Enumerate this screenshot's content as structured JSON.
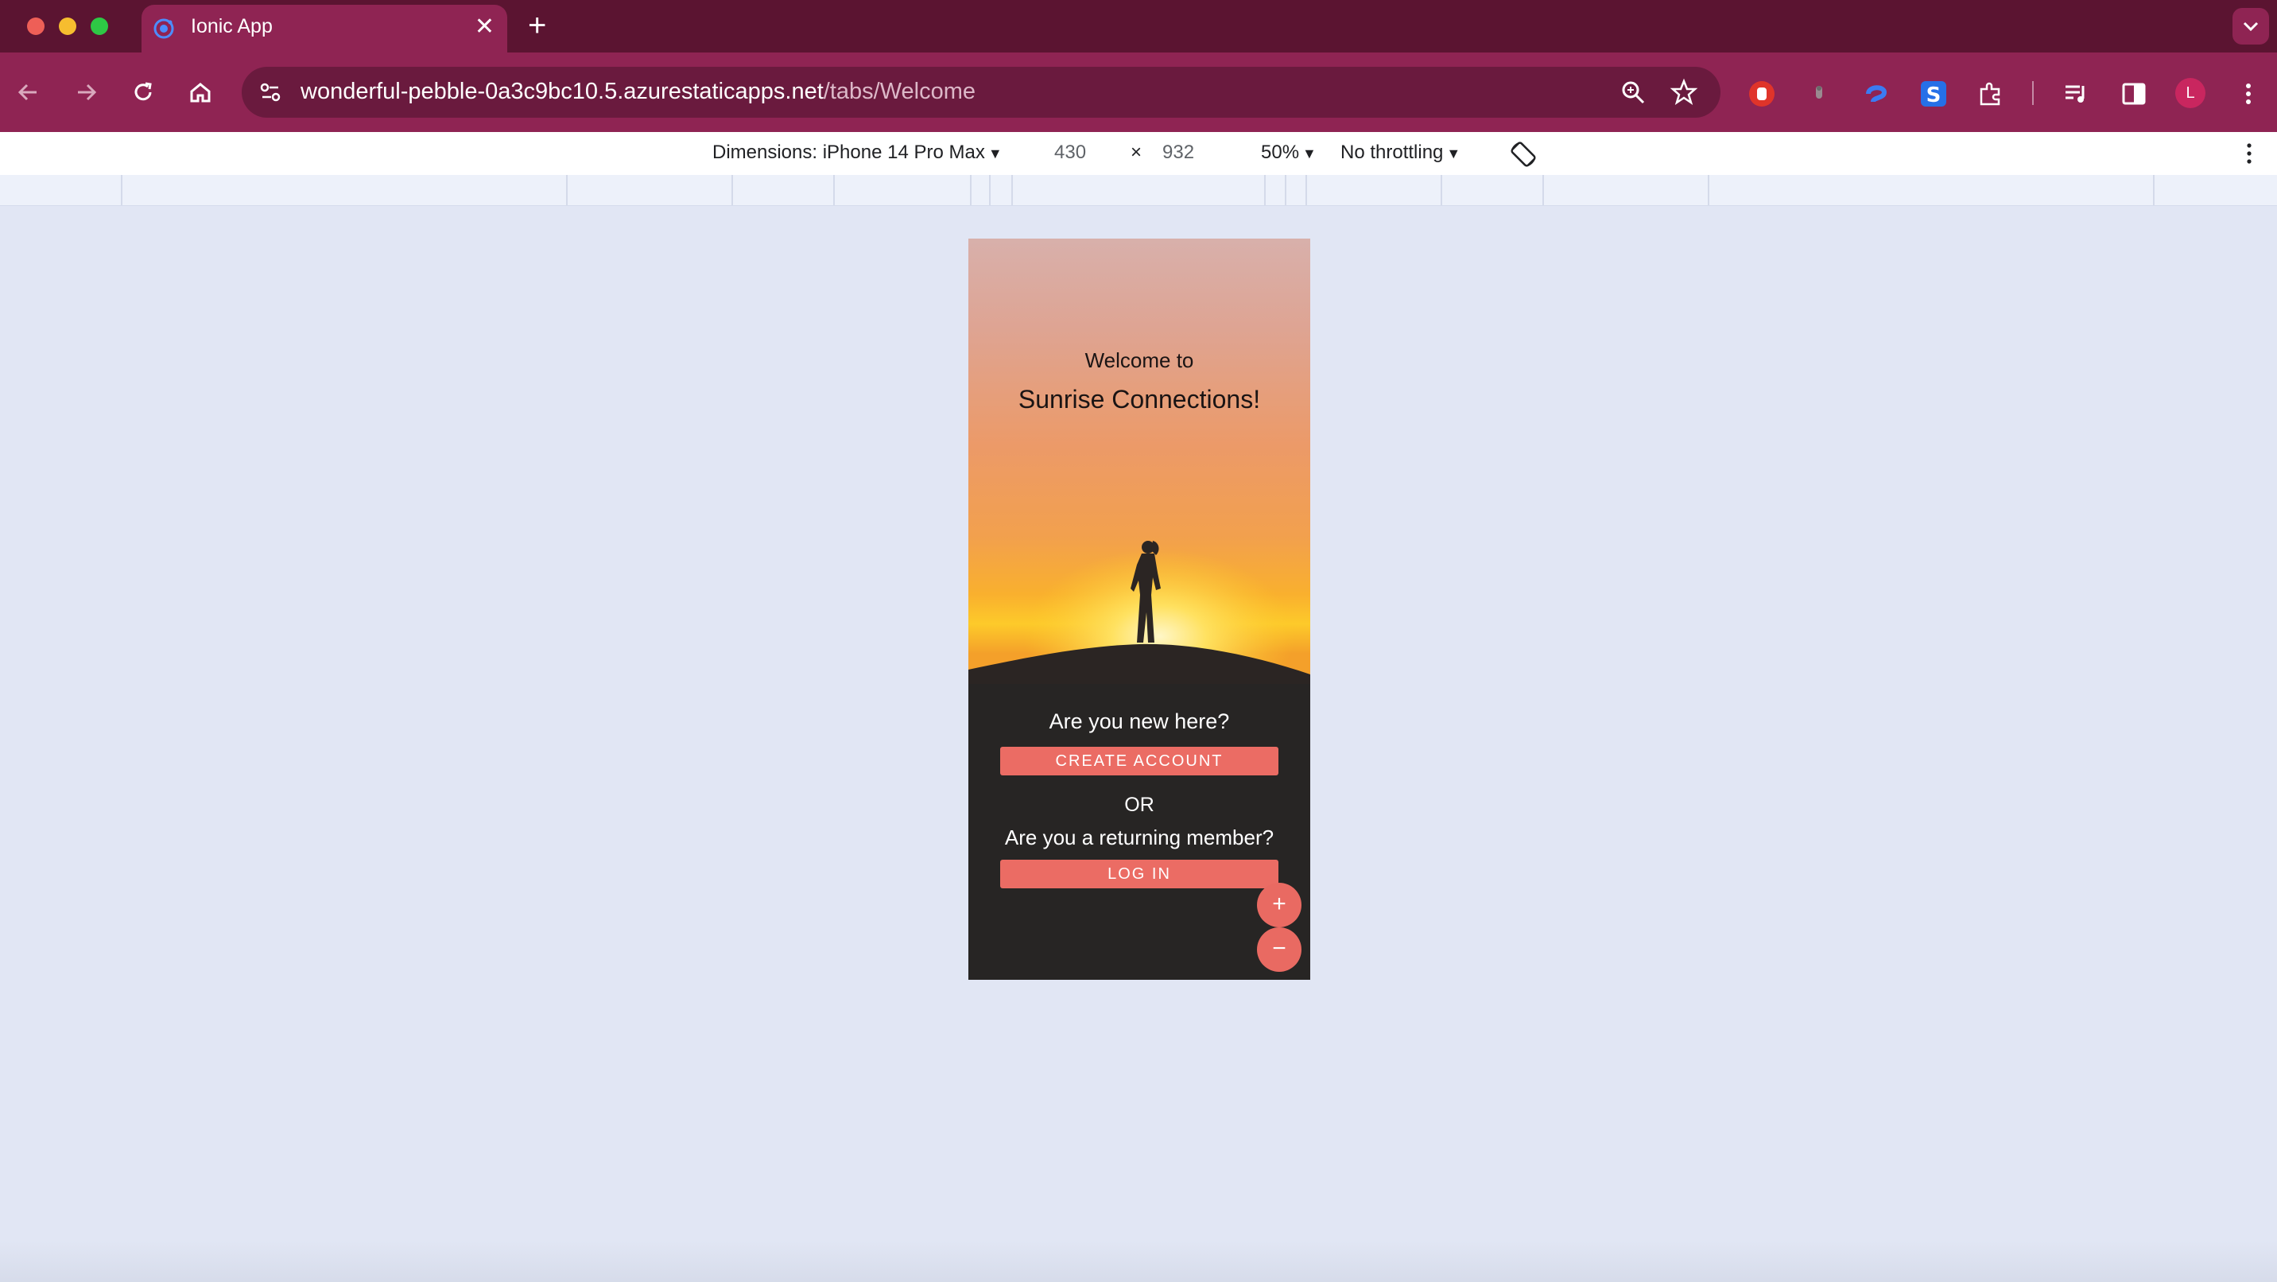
{
  "browser": {
    "tab_title": "Ionic App",
    "tab_close": "✕",
    "new_tab": "+",
    "url_host": "wonderful-pebble-0a3c9bc10.5.azurestaticapps.net",
    "url_path": "/tabs/Welcome",
    "profile_initial": "L",
    "accent": "#8f2453",
    "tabstrip_color": "#5b1431"
  },
  "devtools": {
    "dimensions_label": "Dimensions: iPhone 14 Pro Max",
    "width_value": "430",
    "times": "×",
    "height_value": "932",
    "zoom": "50%",
    "throttling": "No throttling"
  },
  "app": {
    "welcome_line": "Welcome to",
    "brand_line": "Sunrise Connections!",
    "new_prompt": "Are you new here?",
    "create_button": "CREATE ACCOUNT",
    "or_text": "OR",
    "returning_prompt": "Are you a returning member?",
    "login_button": "LOG IN",
    "fab_plus": "+",
    "fab_minus": "−",
    "button_color": "#eb6c64",
    "panel_color": "#272524"
  },
  "icons": [
    "back-arrow-icon",
    "forward-arrow-icon",
    "reload-icon",
    "home-icon",
    "site-settings-icon",
    "zoom-icon",
    "bookmark-star-icon",
    "extension-icons",
    "side-panel-icon",
    "menu-kebab-icon",
    "rotate-icon"
  ]
}
